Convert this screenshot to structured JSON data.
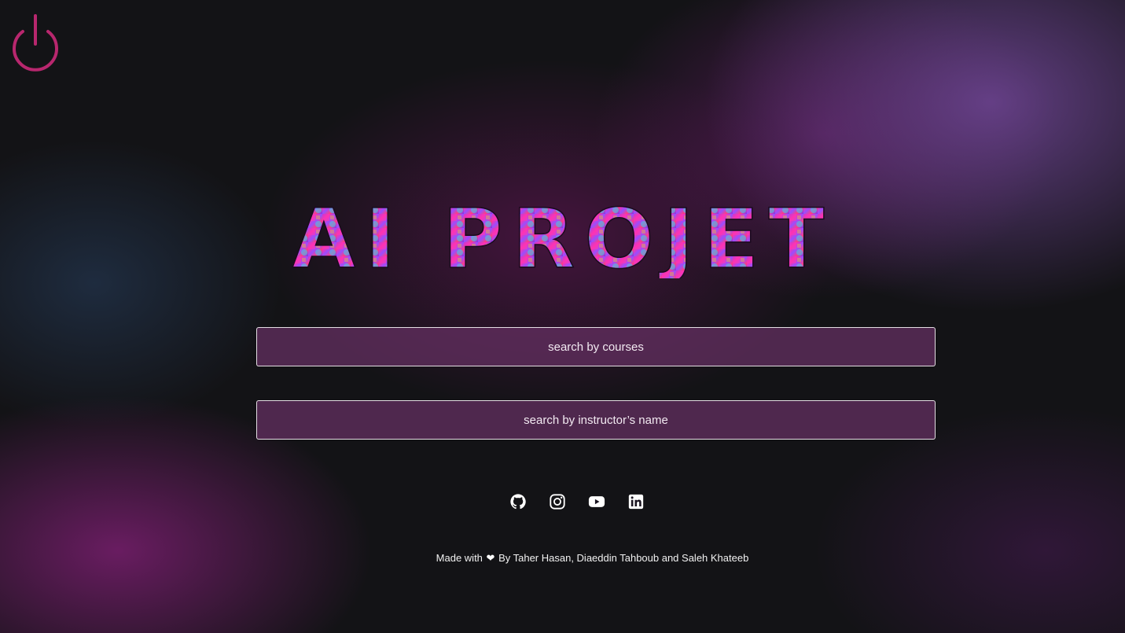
{
  "page": {
    "title": "AI PROJET",
    "power_icon": "power-icon",
    "accent_color": "#b8276e"
  },
  "search": {
    "courses_placeholder": "search by courses",
    "instructor_placeholder": "search by instructor’s name"
  },
  "social_links": [
    {
      "icon": "github-icon"
    },
    {
      "icon": "instagram-icon"
    },
    {
      "icon": "youtube-icon"
    },
    {
      "icon": "linkedin-icon"
    }
  ],
  "footer": {
    "prefix": "Made with",
    "heart_icon": "heart-icon",
    "suffix": "By Taher Hasan, Diaeddin Tahboub and Saleh Khateeb"
  }
}
